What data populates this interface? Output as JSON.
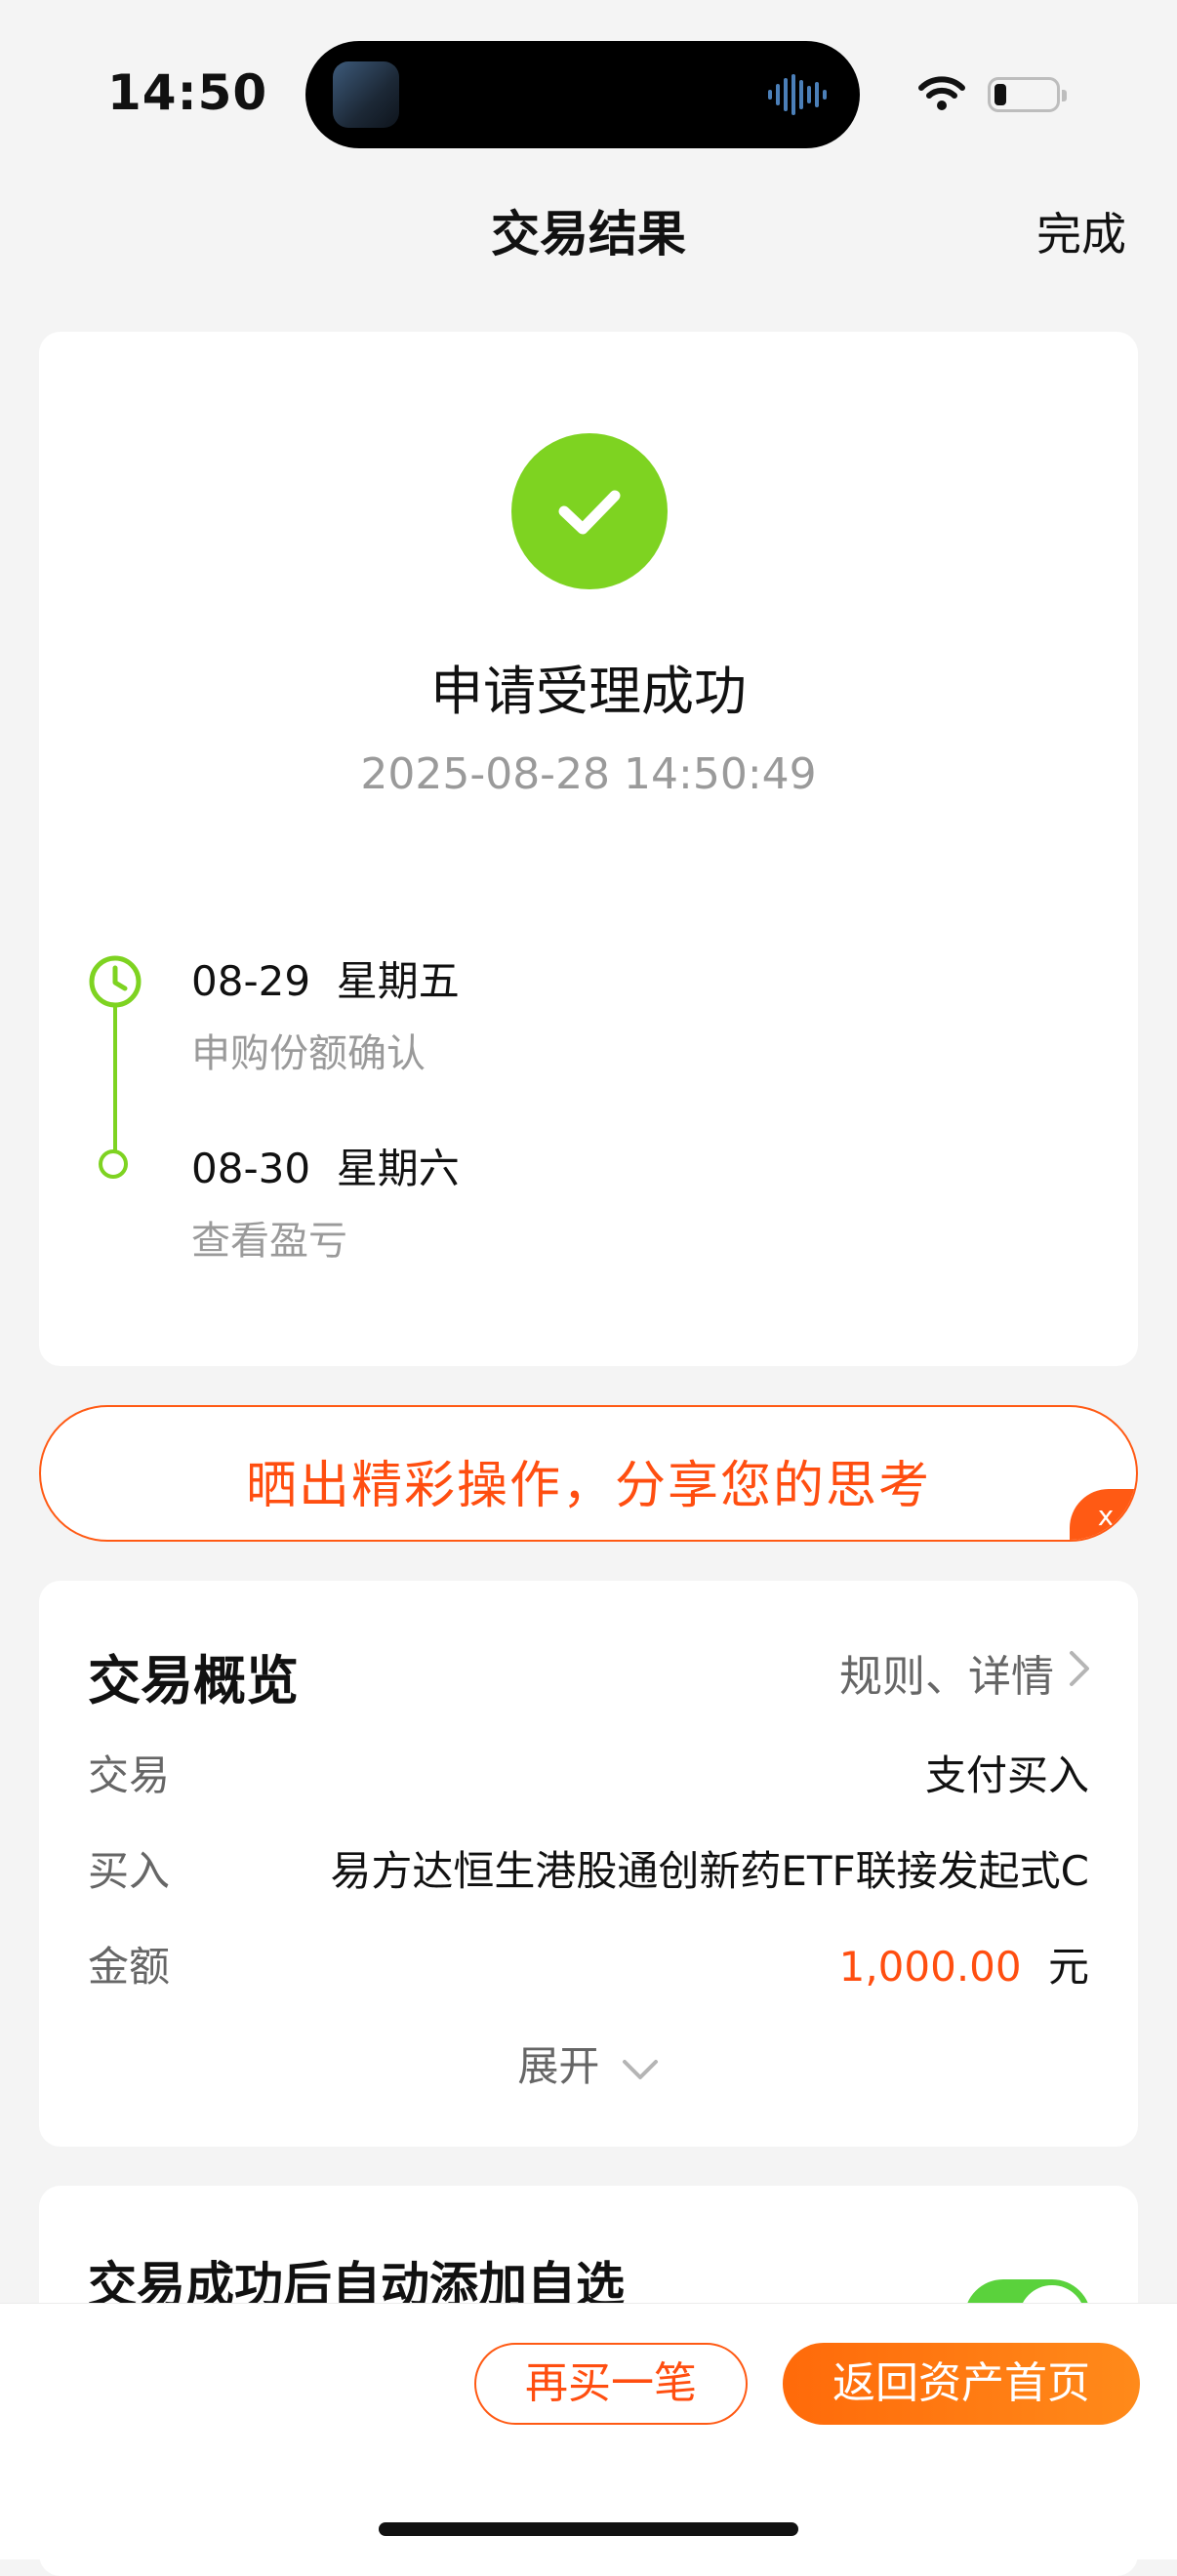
{
  "status_bar": {
    "time": "14:50"
  },
  "nav": {
    "title": "交易结果",
    "done": "完成"
  },
  "result": {
    "title": "申请受理成功",
    "timestamp": "2025-08-28 14:50:49",
    "steps": [
      {
        "date": "08-29  星期五",
        "desc": "申购份额确认"
      },
      {
        "date": "08-30  星期六",
        "desc": "查看盈亏"
      }
    ],
    "accent_color": "#7ed321"
  },
  "share_banner": {
    "text": "晒出精彩操作，分享您的思考",
    "close_label": "x",
    "color": "#ff4e10"
  },
  "overview": {
    "title": "交易概览",
    "link": "规则、详情",
    "rows": [
      {
        "label": "交易",
        "value": "支付买入"
      },
      {
        "label": "买入",
        "value": "易方达恒生港股通创新药ETF联接发起式C"
      },
      {
        "label": "金额",
        "amount": "1,000.00",
        "unit": "元"
      }
    ],
    "expand_label": "展开"
  },
  "auto_add": {
    "title": "交易成功后自动添加自选",
    "enabled": true
  },
  "actions": {
    "buy_again": "再买一笔",
    "back_home": "返回资产首页"
  }
}
